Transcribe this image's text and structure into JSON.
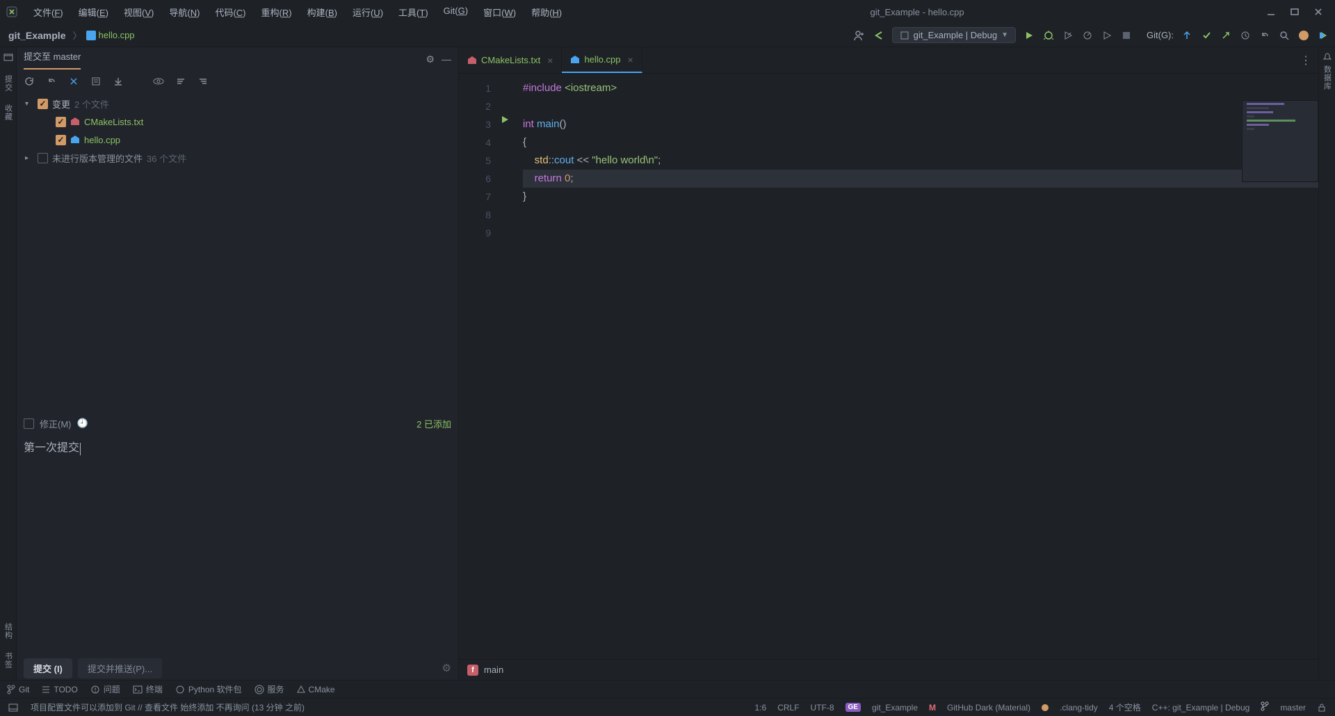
{
  "window": {
    "title": "git_Example - hello.cpp"
  },
  "menu": [
    {
      "label": "文件",
      "hotkey": "F"
    },
    {
      "label": "编辑",
      "hotkey": "E"
    },
    {
      "label": "视图",
      "hotkey": "V"
    },
    {
      "label": "导航",
      "hotkey": "N"
    },
    {
      "label": "代码",
      "hotkey": "C"
    },
    {
      "label": "重构",
      "hotkey": "R"
    },
    {
      "label": "构建",
      "hotkey": "B"
    },
    {
      "label": "运行",
      "hotkey": "U"
    },
    {
      "label": "工具",
      "hotkey": "T"
    },
    {
      "label": "Git",
      "hotkey": "G"
    },
    {
      "label": "窗口",
      "hotkey": "W"
    },
    {
      "label": "帮助",
      "hotkey": "H"
    }
  ],
  "breadcrumbs": {
    "project": "git_Example",
    "file": "hello.cpp"
  },
  "run_config": {
    "label": "git_Example | Debug"
  },
  "git_label": "Git(G):",
  "left_gutter": {
    "items": [
      "项目",
      "提交",
      "收藏"
    ]
  },
  "left_bottom": {
    "items": [
      "结构",
      "书签"
    ]
  },
  "right_gutter": {
    "items": [
      "通知",
      "数据库"
    ]
  },
  "commit": {
    "title": "提交至 master",
    "changes_label": "变更",
    "changes_count": "2 个文件",
    "files": [
      {
        "name": "CMakeLists.txt",
        "icon": "cmake"
      },
      {
        "name": "hello.cpp",
        "icon": "cpp"
      }
    ],
    "unversioned_label": "未进行版本管理的文件",
    "unversioned_count": "36 个文件",
    "amend_label": "修正(M)",
    "added_label": "2 已添加",
    "message": "第一次提交",
    "commit_btn": "提交 (I)",
    "push_btn": "提交并推送(P)..."
  },
  "tabs": [
    {
      "name": "CMakeLists.txt",
      "active": false,
      "green": true
    },
    {
      "name": "hello.cpp",
      "active": true,
      "green": true
    }
  ],
  "code": {
    "lines": [
      {
        "n": 1,
        "html": "<span class='kw-pre'>#include</span> <span class='incname'>&lt;iostream&gt;</span>"
      },
      {
        "n": 2,
        "html": ""
      },
      {
        "n": 3,
        "html": "<span class='kw-type'>int</span> <span class='fn'>main</span><span class='punct'>()</span>",
        "run": true
      },
      {
        "n": 4,
        "html": "<span class='punct'>{</span>"
      },
      {
        "n": 5,
        "html": "    <span class='ns'>std</span><span class='punct'>::</span><span class='name'>cout</span> <span class='punct'>&lt;&lt;</span> <span class='str'>\"hello world\\n\"</span><span class='punct'>;</span>"
      },
      {
        "n": 6,
        "html": "    <span class='kw-ret'>return</span> <span class='num'>0</span><span class='punct'>;</span>",
        "hl": true
      },
      {
        "n": 7,
        "html": "<span class='punct'>}</span>"
      },
      {
        "n": 8,
        "html": ""
      },
      {
        "n": 9,
        "html": ""
      }
    ],
    "function_crumb": "main"
  },
  "bottom_tools": [
    {
      "icon": "branch",
      "label": "Git"
    },
    {
      "icon": "list",
      "label": "TODO"
    },
    {
      "icon": "warn",
      "label": "问题"
    },
    {
      "icon": "terminal",
      "label": "终端"
    },
    {
      "icon": "python",
      "label": "Python 软件包"
    },
    {
      "icon": "services",
      "label": "服务"
    },
    {
      "icon": "cmake",
      "label": "CMake"
    }
  ],
  "status": {
    "left": "项目配置文件可以添加到 Git // 查看文件   始终添加   不再询问 (13 分钟 之前)",
    "pos": "1:6",
    "eol": "CRLF",
    "enc": "UTF-8",
    "project": "git_Example",
    "theme": "GitHub Dark (Material)",
    "clang": ".clang-tidy",
    "indent": "4 个空格",
    "config": "C++: git_Example | Debug",
    "branch": "master"
  }
}
